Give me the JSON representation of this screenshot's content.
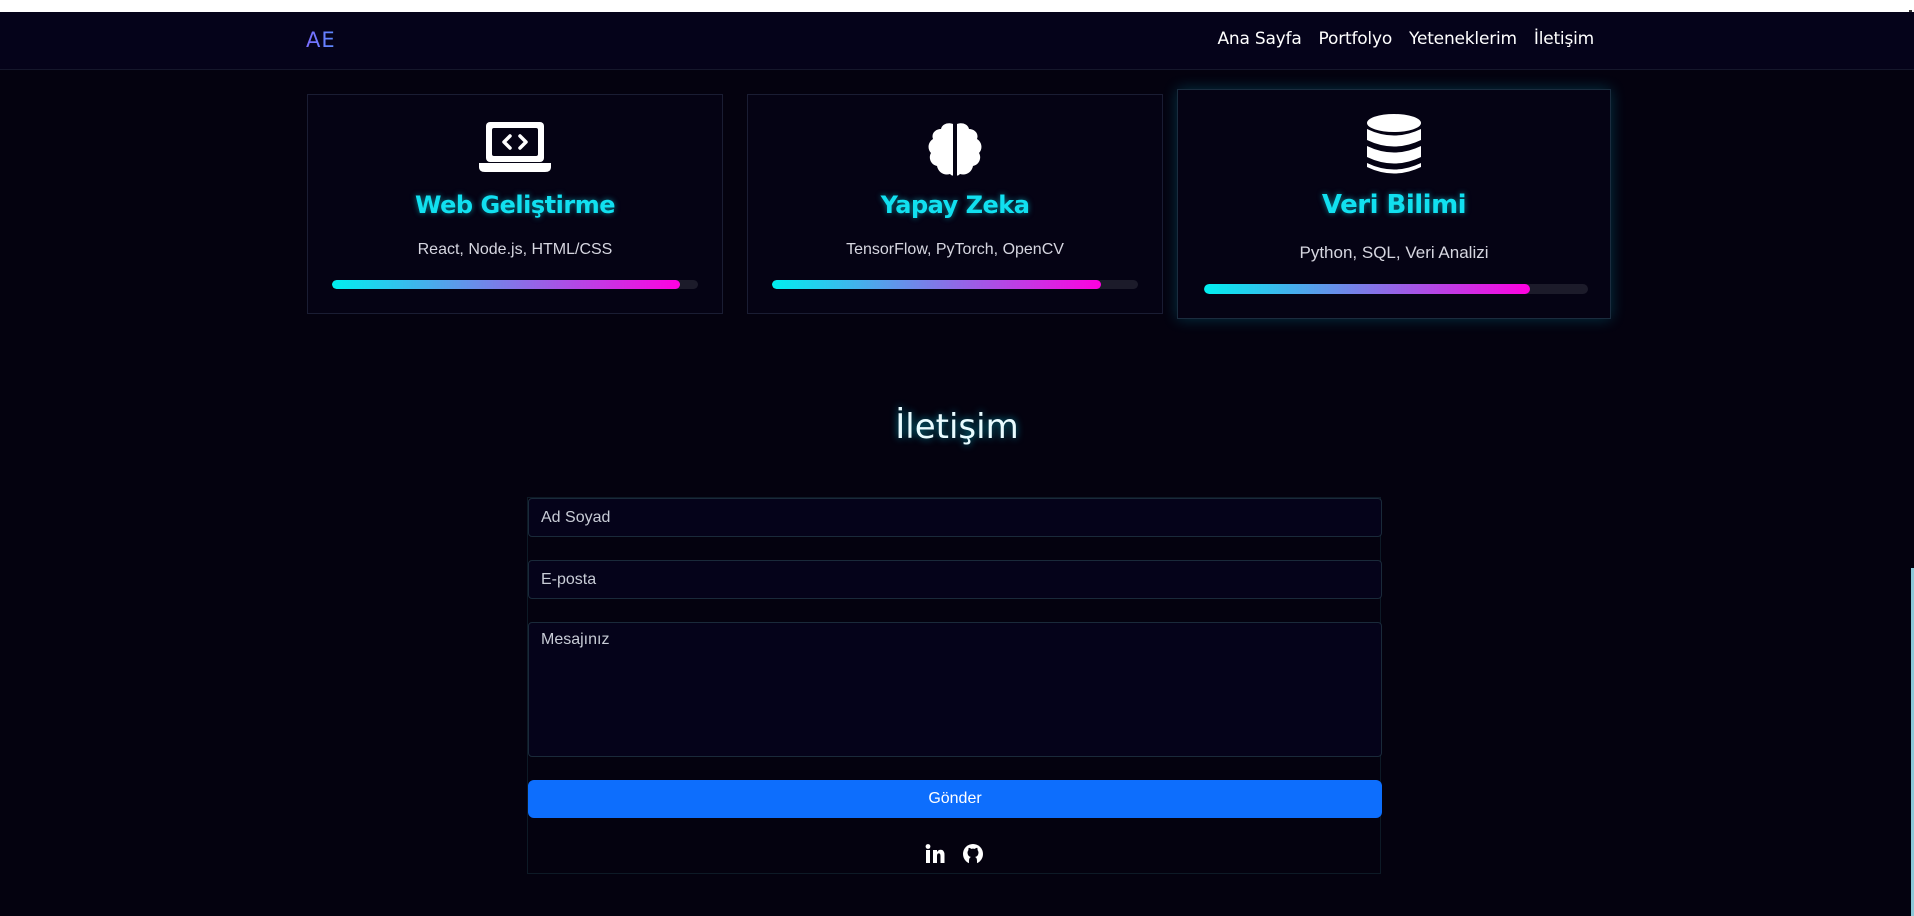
{
  "nav": {
    "logo": "AE",
    "links": [
      "Ana Sayfa",
      "Portfolyo",
      "Yeteneklerim",
      "İletişim"
    ]
  },
  "skills": [
    {
      "icon": "laptop-code-icon",
      "title": "Web Geliştirme",
      "desc": "React, Node.js, HTML/CSS",
      "level": 0.95
    },
    {
      "icon": "brain-icon",
      "title": "Yapay Zeka",
      "desc": "TensorFlow, PyTorch, OpenCV",
      "level": 0.9
    },
    {
      "icon": "database-icon",
      "title": "Veri Bilimi",
      "desc": "Python, SQL, Veri Analizi",
      "level": 0.85
    }
  ],
  "contact": {
    "title": "İletişim",
    "name_placeholder": "Ad Soyad",
    "email_placeholder": "E-posta",
    "message_placeholder": "Mesajınız",
    "submit_label": "Gönder",
    "socials": [
      "linkedin-icon",
      "github-icon"
    ]
  },
  "colors": {
    "accent_cyan": "#11e0f0",
    "accent_magenta": "#ff00e0",
    "button_blue": "#0d6efd",
    "background": "#04020f"
  }
}
